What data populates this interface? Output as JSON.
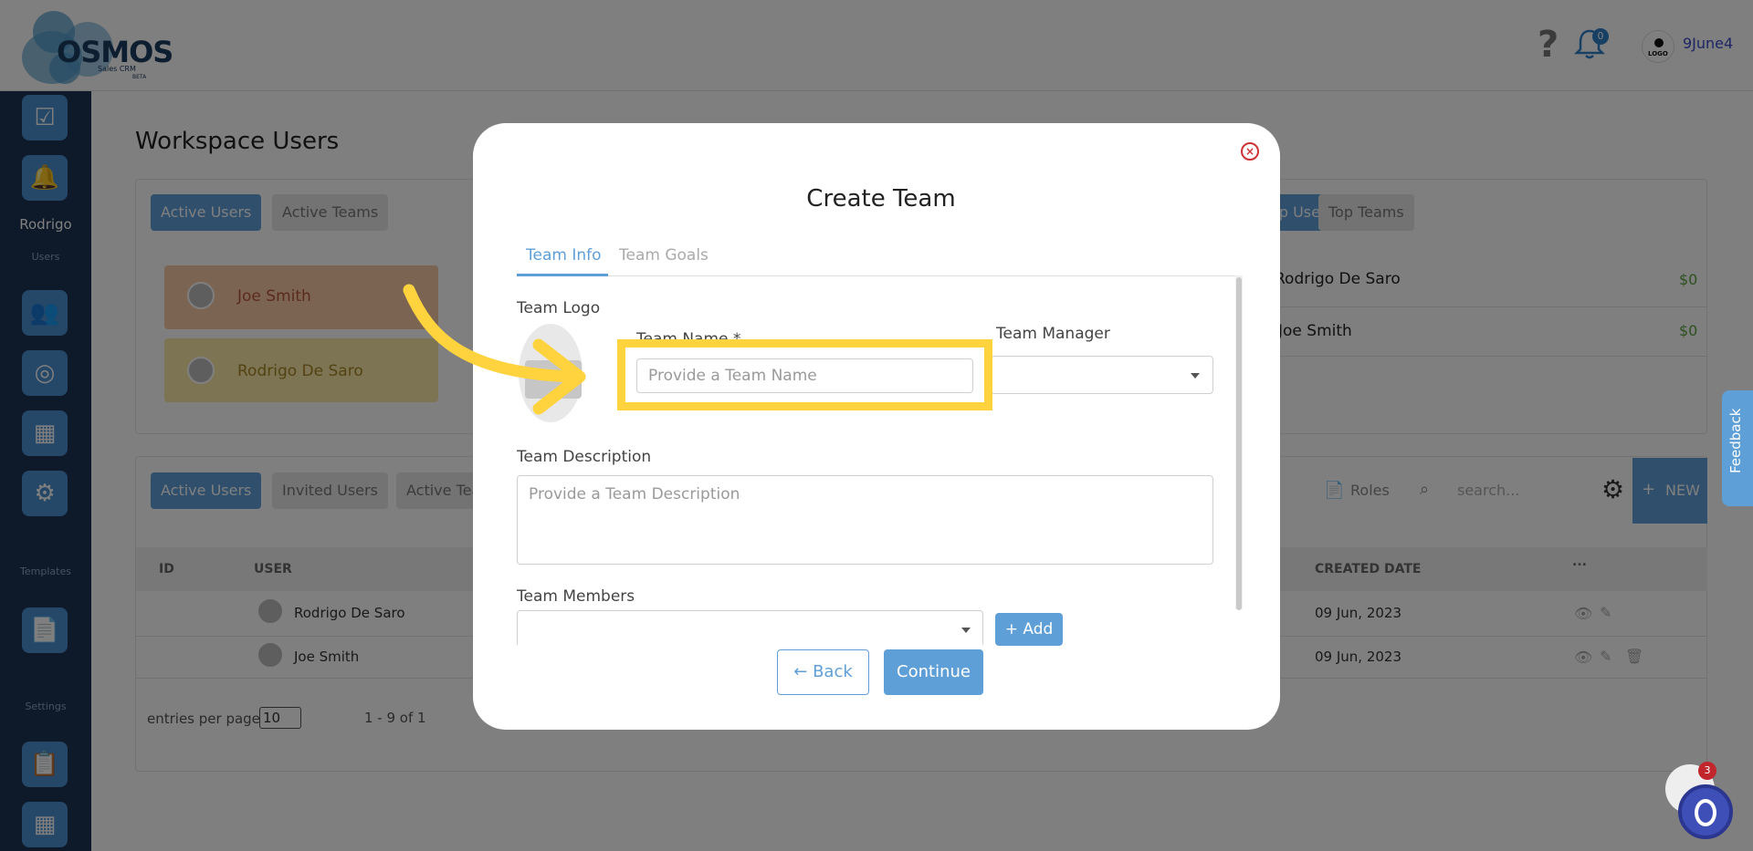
{
  "header": {
    "logo_text": "OSMOS",
    "logo_sub": "Sales CRM",
    "logo_beta": "BETA",
    "help_icon": "?",
    "notification_count": "0",
    "avatar_text": "LOGO",
    "username": "9June4"
  },
  "sidebar": {
    "user_name": "Rodrigo",
    "user_caption": "Users",
    "templates_caption": "Templates",
    "settings_caption": "Settings"
  },
  "page": {
    "title": "Workspace Users",
    "top_tabs": [
      "Active Users",
      "Active Teams"
    ],
    "right_tabs": [
      "Top Users",
      "Top Teams"
    ],
    "top_rows": [
      {
        "name": "Joe Smith"
      },
      {
        "name": "Rodrigo De Saro"
      }
    ],
    "top_users_right": [
      {
        "name": "Rodrigo De Saro",
        "amount": "$0"
      },
      {
        "name": "Joe Smith",
        "amount": "$0"
      }
    ],
    "bottom_tabs": [
      "Active Users",
      "Invited Users",
      "Active Teams"
    ],
    "roles_label": "Roles",
    "search_placeholder": "search...",
    "new_label": "NEW",
    "columns": {
      "id": "ID",
      "user": "USER",
      "created": "CREATED DATE",
      "more": "..."
    },
    "table_rows": [
      {
        "user": "Rodrigo De Saro",
        "created": "09 Jun, 2023"
      },
      {
        "user": "Joe Smith",
        "created": "09 Jun, 2023"
      }
    ],
    "entries_label": "entries per page",
    "entries_value": "10",
    "range_label": "1 - 9 of 1"
  },
  "modal": {
    "title": "Create Team",
    "close": "×",
    "tab_info": "Team Info",
    "tab_goals": "Team Goals",
    "logo_label": "Team Logo",
    "name_label": "Team Name *",
    "name_placeholder": "Provide a Team Name",
    "manager_label": "Team Manager",
    "description_label": "Team Description",
    "description_placeholder": "Provide a Team Description",
    "members_label": "Team Members",
    "add_label": "+ Add",
    "back_label": "Back",
    "continue_label": "Continue"
  },
  "widgets": {
    "feedback": "Feedback",
    "chat_badge": "3"
  },
  "colors": {
    "accent": "#5f9fd8",
    "sidebar": "#1c3553",
    "highlight": "#ffd33e"
  }
}
